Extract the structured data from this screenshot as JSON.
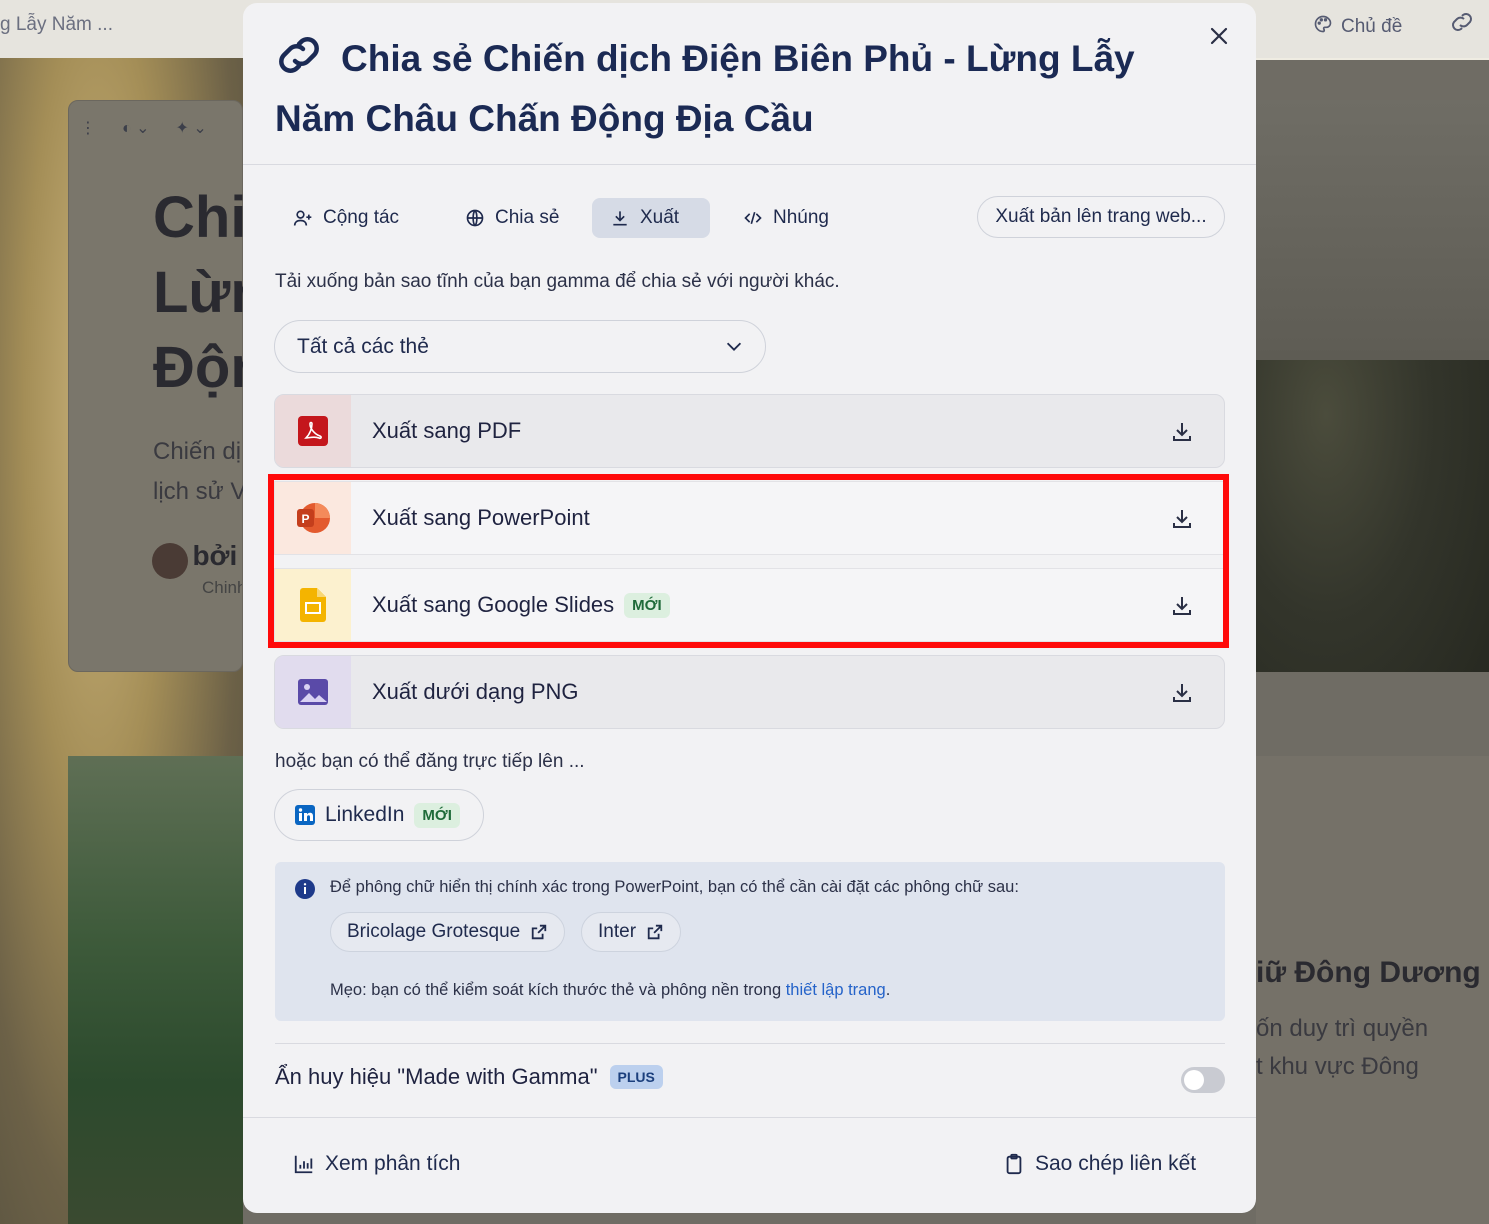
{
  "background": {
    "breadcrumb": "g Lẫy Năm ...",
    "theme_label": "Chủ đề",
    "card_title": "Chiến dịch Điện Biên Phủ - Lừng Lẫy Năm Châu Chấn Động Địa Cầu",
    "card_title_lines": [
      "Chi",
      "Lừn",
      "Độn"
    ],
    "card_desc_lines": [
      "Chiến dị",
      "lịch sử V"
    ],
    "author_by": "bởi",
    "author_sub": "Chinh",
    "right_heading": "iữ Đông Dương",
    "right_text_lines": [
      "ốn duy trì quyền",
      "t khu vực Đông"
    ]
  },
  "modal": {
    "title": "Chia sẻ Chiến dịch Điện Biên Phủ - Lừng Lẫy Năm Châu Chấn Động Địa Cầu",
    "close_icon": "×",
    "tabs": [
      {
        "label": "Cộng tác",
        "icon": "add-user-icon"
      },
      {
        "label": "Chia sẻ",
        "icon": "globe-icon"
      },
      {
        "label": "Xuất",
        "icon": "download-icon",
        "active": true
      },
      {
        "label": "Nhúng",
        "icon": "code-icon"
      }
    ],
    "publish_button": "Xuất bản lên trang web...",
    "description": "Tải xuống bản sao tĩnh của bạn gamma để chia sẻ với người khác.",
    "card_select": "Tất cả các thẻ",
    "exports": [
      {
        "label": "Xuất sang PDF",
        "icon": "pdf-icon",
        "color": "#c4161c"
      },
      {
        "label": "Xuất sang PowerPoint",
        "icon": "powerpoint-icon",
        "color": "#d24726"
      },
      {
        "label": "Xuất sang Google Slides",
        "badge": "MỚI",
        "icon": "google-slides-icon",
        "color": "#f4b400"
      },
      {
        "label": "Xuất dưới dạng PNG",
        "icon": "image-icon",
        "color": "#5a4aa8"
      }
    ],
    "or_text": "hoặc bạn có thể đăng trực tiếp lên ...",
    "linkedin": {
      "label": "LinkedIn",
      "badge": "MỚI"
    },
    "info": {
      "text": "Để phông chữ hiển thị chính xác trong PowerPoint, bạn có thể cần cài đặt các phông chữ sau:",
      "fonts": [
        "Bricolage Grotesque",
        "Inter"
      ],
      "tip_prefix": "Mẹo: bạn có thể kiểm soát kích thước thẻ và phông nền trong ",
      "tip_link": "thiết lập trang",
      "tip_suffix": "."
    },
    "hide_badge": {
      "label": "Ẩn huy hiệu \"Made with Gamma\"",
      "plan": "PLUS",
      "enabled": false
    },
    "footer": {
      "analytics": "Xem phân tích",
      "copy_link": "Sao chép liên kết"
    }
  },
  "colors": {
    "title": "#1b2a54",
    "highlight": "#ff0a0a",
    "link": "#2563c9"
  }
}
